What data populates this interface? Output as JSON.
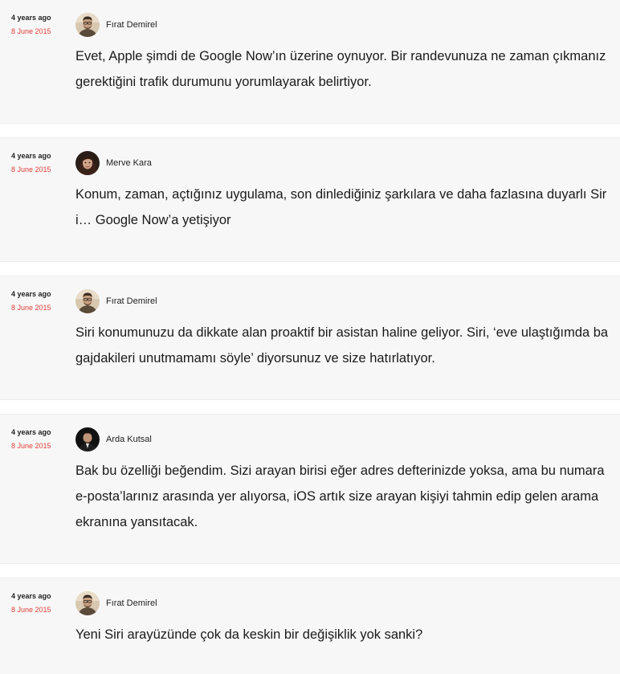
{
  "entries": [
    {
      "ago": "4 years ago",
      "date": "8 June 2015",
      "author": "Fırat Demirel",
      "avatar_icon": "avatar-firat-icon",
      "text": "Evet, Apple şimdi de Google Now’ın üzerine oynuyor. Bir randevunuza ne zaman çıkmanız gerektiğini trafik durumunu yorumlayarak belirtiyor."
    },
    {
      "ago": "4 years ago",
      "date": "8 June 2015",
      "author": "Merve Kara",
      "avatar_icon": "avatar-merve-icon",
      "text": "Konum, zaman, açtığınız uygulama, son dinlediğiniz şarkılara ve daha fazlasına duyarlı Siri… Google Now’a yetişiyor"
    },
    {
      "ago": "4 years ago",
      "date": "8 June 2015",
      "author": "Fırat Demirel",
      "avatar_icon": "avatar-firat-icon",
      "text": "Siri konumunuzu da dikkate alan proaktif bir asistan haline geliyor. Siri, ‘eve ulaştığımda bagajdakileri unutmamamı söyle’ diyorsunuz ve size hatırlatıyor."
    },
    {
      "ago": "4 years ago",
      "date": "8 June 2015",
      "author": "Arda Kutsal",
      "avatar_icon": "avatar-arda-icon",
      "text": "Bak bu özelliği beğendim. Sizi arayan birisi eğer adres defterinizde yoksa, ama bu numara e-posta’larınız arasında yer alıyorsa, iOS artık size arayan kişiyi tahmin edip gelen arama ekranına yansıtacak."
    },
    {
      "ago": "4 years ago",
      "date": "8 June 2015",
      "author": "Fırat Demirel",
      "avatar_icon": "avatar-firat-icon",
      "text": "Yeni Siri arayüzünde çok da keskin bir değişiklik yok sanki?"
    }
  ],
  "colors": {
    "entry_background": "#f7f7f7",
    "date_accent": "#e0403a",
    "text": "#1a1a1a"
  }
}
